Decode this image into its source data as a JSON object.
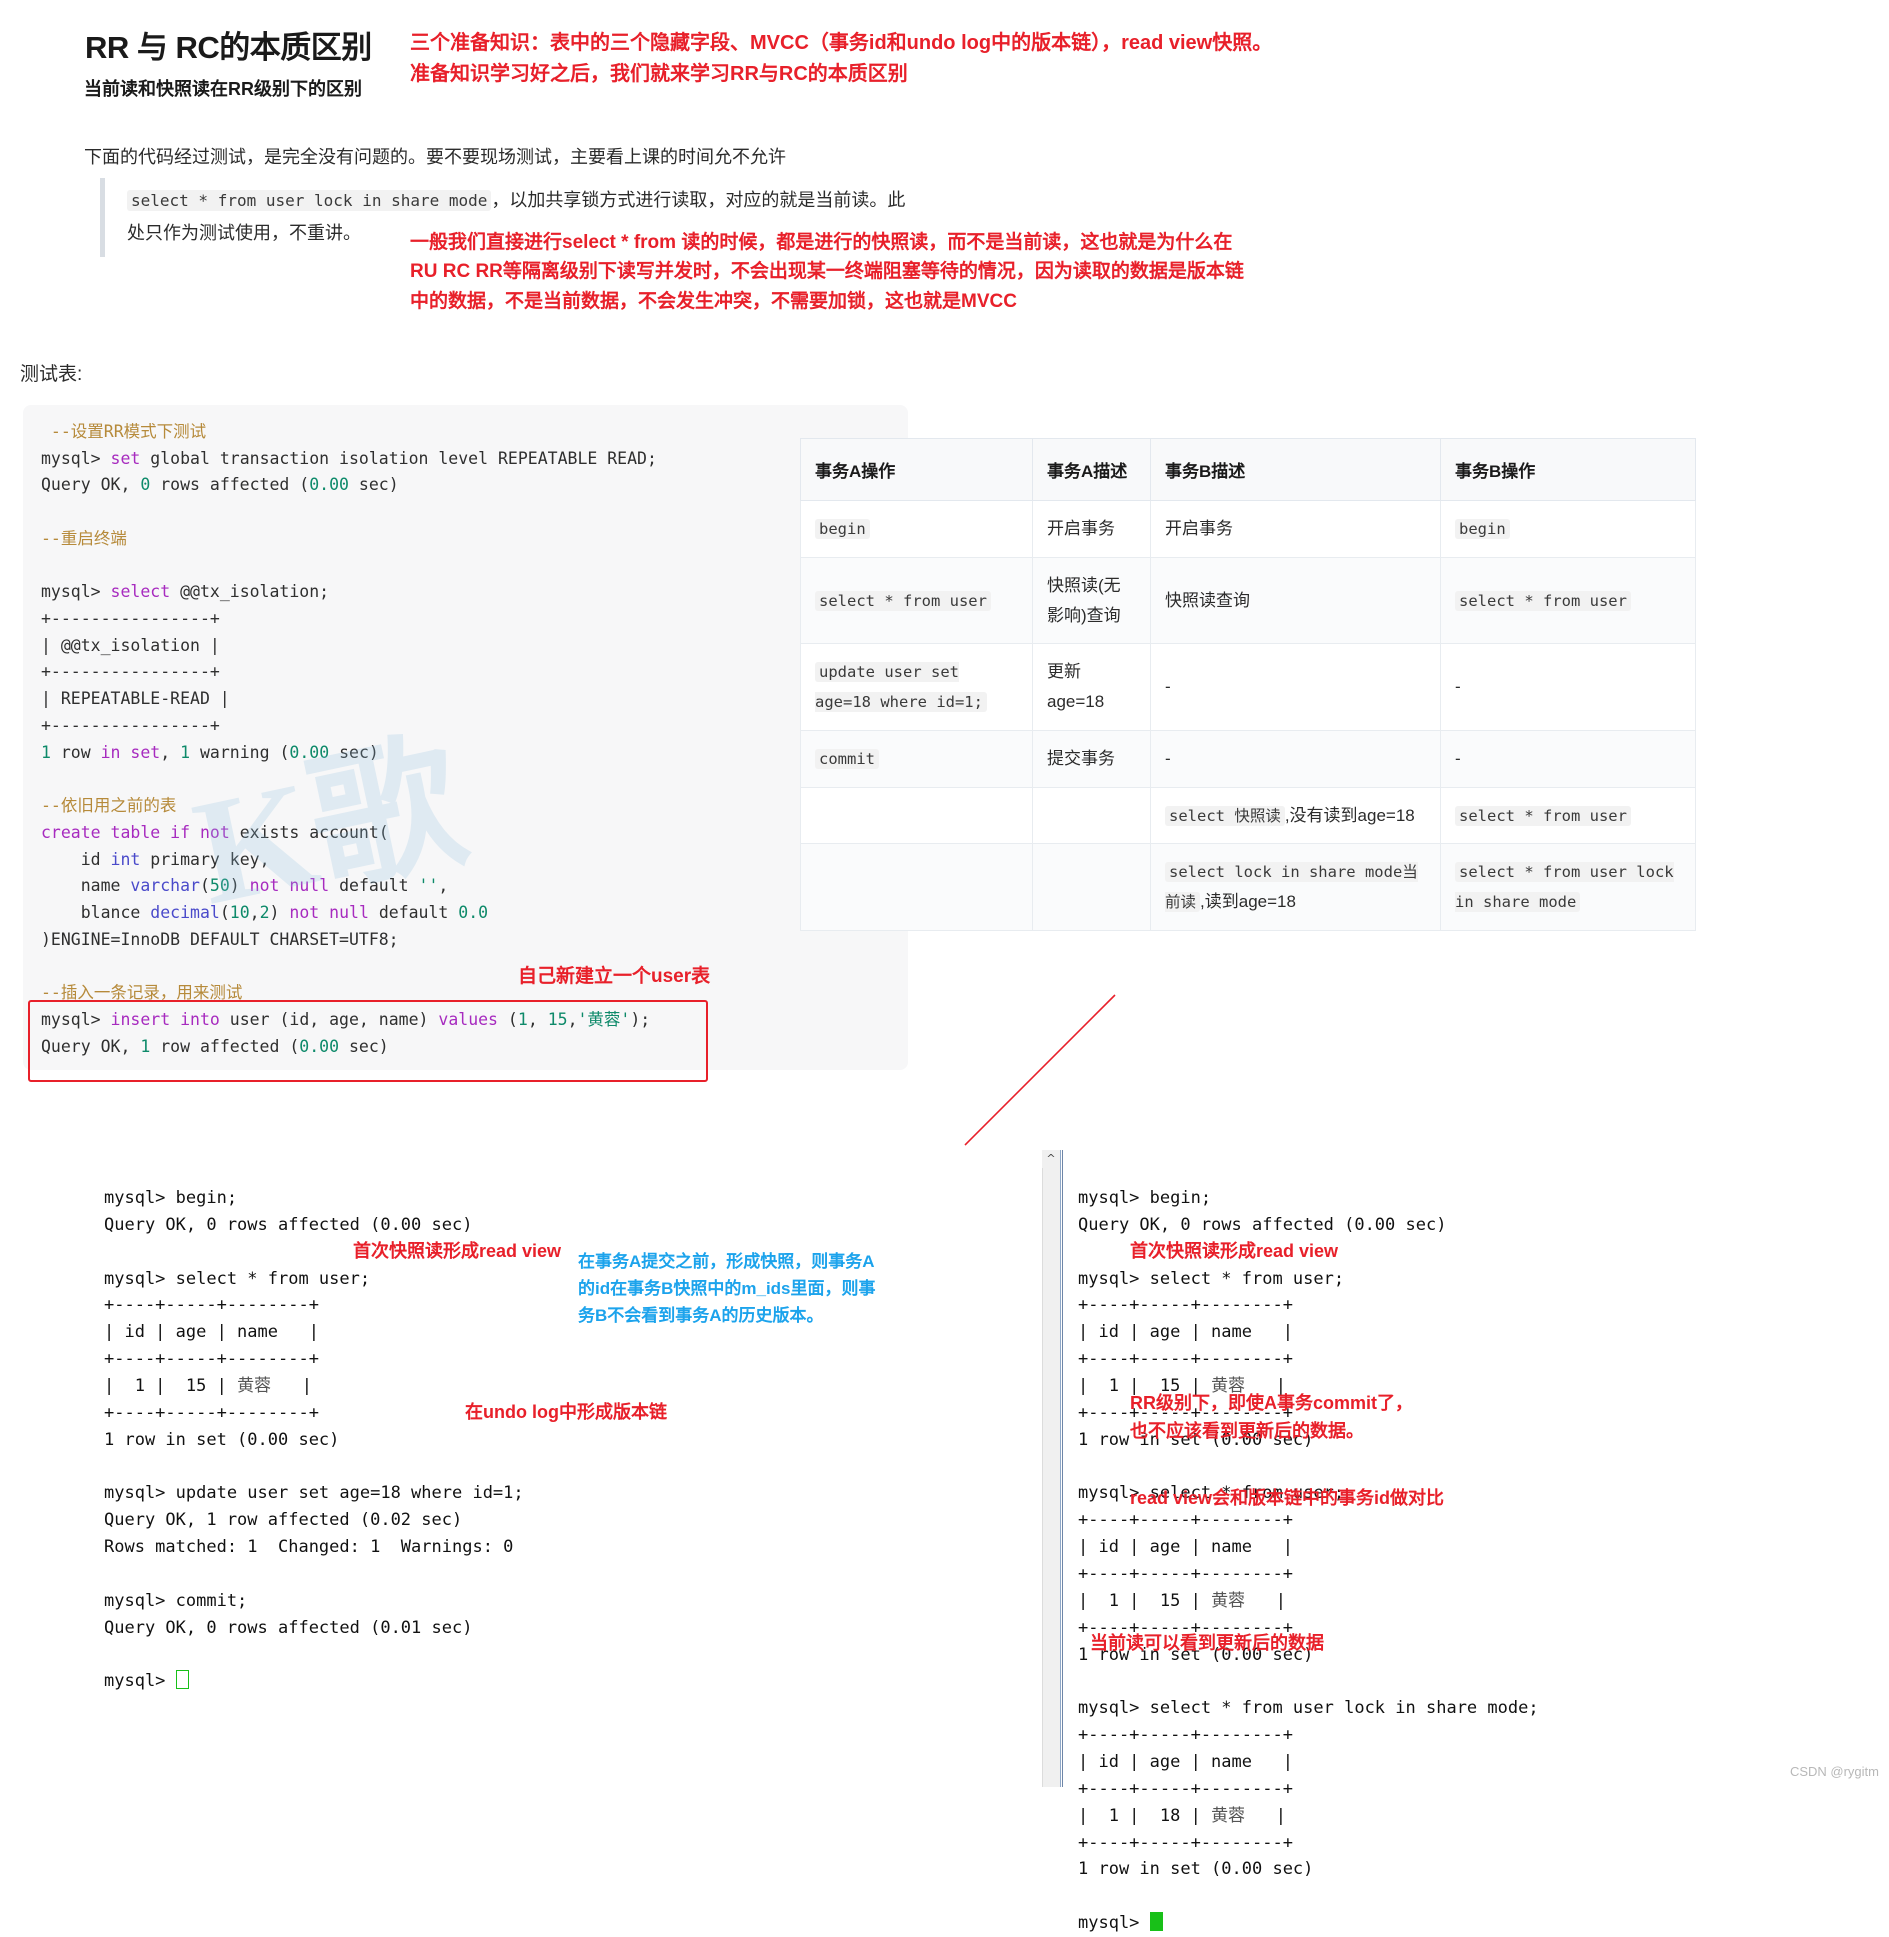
{
  "header": {
    "title": "RR 与 RC的本质区别",
    "subtitle": "当前读和快照读在RR级别下的区别",
    "intro": "下面的代码经过测试，是完全没有问题的。要不要现场测试，主要看上课的时间允不允许",
    "red_note_line1": "三个准备知识：表中的三个隐藏字段、MVCC（事务id和undo log中的版本链），read view快照。",
    "red_note_line2": "准备知识学习好之后，我们就来学习RR与RC的本质区别"
  },
  "quote": {
    "code_inline": "select * from user lock in share mode",
    "text_after": "，以加共享锁方式进行读取，对应的就是当前读。此",
    "line2": "处只作为测试使用，不重讲。"
  },
  "body_red_note": {
    "line1": "一般我们直接进行select * from 读的时候，都是进行的快照读，而不是当前读，这也就是为什么在",
    "line2": "RU RC RR等隔离级别下读写并发时，不会出现某一终端阻塞等待的情况，因为读取的数据是版本链",
    "line3": "中的数据，不是当前数据，不会发生冲突，不需要加锁，这也就是MVCC"
  },
  "test_table_label": "测试表:",
  "code_block": {
    "lines": [
      [
        {
          "t": " --设置RR模式下测试",
          "c": "c-comment"
        }
      ],
      [
        {
          "t": "mysql> ",
          "c": "c-plain"
        },
        {
          "t": "set",
          "c": "c-kw"
        },
        {
          "t": " global transaction isolation level REPEATABLE READ;",
          "c": "c-plain"
        }
      ],
      [
        {
          "t": "Query OK, ",
          "c": "c-plain"
        },
        {
          "t": "0",
          "c": "c-num"
        },
        {
          "t": " rows affected (",
          "c": "c-plain"
        },
        {
          "t": "0.00",
          "c": "c-num"
        },
        {
          "t": " sec)",
          "c": "c-plain"
        }
      ],
      [
        {
          "t": "",
          "c": "c-plain"
        }
      ],
      [
        {
          "t": "--重启终端",
          "c": "c-comment"
        }
      ],
      [
        {
          "t": "",
          "c": "c-plain"
        }
      ],
      [
        {
          "t": "mysql> ",
          "c": "c-plain"
        },
        {
          "t": "select",
          "c": "c-kw"
        },
        {
          "t": " @@tx_isolation;",
          "c": "c-plain"
        }
      ],
      [
        {
          "t": "+----------------+",
          "c": "c-plain"
        }
      ],
      [
        {
          "t": "| @@tx_isolation |",
          "c": "c-plain"
        }
      ],
      [
        {
          "t": "+----------------+",
          "c": "c-plain"
        }
      ],
      [
        {
          "t": "| REPEATABLE-READ |",
          "c": "c-plain"
        }
      ],
      [
        {
          "t": "+----------------+",
          "c": "c-plain"
        }
      ],
      [
        {
          "t": "1",
          "c": "c-num"
        },
        {
          "t": " row ",
          "c": "c-plain"
        },
        {
          "t": "in",
          "c": "c-kw"
        },
        {
          "t": " ",
          "c": "c-plain"
        },
        {
          "t": "set",
          "c": "c-kw"
        },
        {
          "t": ", ",
          "c": "c-plain"
        },
        {
          "t": "1",
          "c": "c-num"
        },
        {
          "t": " warning (",
          "c": "c-plain"
        },
        {
          "t": "0.00",
          "c": "c-num"
        },
        {
          "t": " sec)",
          "c": "c-plain"
        }
      ],
      [
        {
          "t": "",
          "c": "c-plain"
        }
      ],
      [
        {
          "t": "--依旧用之前的表",
          "c": "c-comment"
        }
      ],
      [
        {
          "t": "create",
          "c": "c-kw"
        },
        {
          "t": " ",
          "c": "c-plain"
        },
        {
          "t": "table",
          "c": "c-kw"
        },
        {
          "t": " ",
          "c": "c-plain"
        },
        {
          "t": "if",
          "c": "c-kw"
        },
        {
          "t": " ",
          "c": "c-plain"
        },
        {
          "t": "not",
          "c": "c-kw"
        },
        {
          "t": " exists account(",
          "c": "c-plain"
        }
      ],
      [
        {
          "t": "    id ",
          "c": "c-plain"
        },
        {
          "t": "int",
          "c": "c-type"
        },
        {
          "t": " primary key,",
          "c": "c-plain"
        }
      ],
      [
        {
          "t": "    name ",
          "c": "c-plain"
        },
        {
          "t": "varchar",
          "c": "c-type"
        },
        {
          "t": "(",
          "c": "c-plain"
        },
        {
          "t": "50",
          "c": "c-num"
        },
        {
          "t": ") ",
          "c": "c-plain"
        },
        {
          "t": "not",
          "c": "c-kw"
        },
        {
          "t": " ",
          "c": "c-plain"
        },
        {
          "t": "null",
          "c": "c-kw"
        },
        {
          "t": " default ",
          "c": "c-plain"
        },
        {
          "t": "''",
          "c": "c-str"
        },
        {
          "t": ",",
          "c": "c-plain"
        }
      ],
      [
        {
          "t": "    blance ",
          "c": "c-plain"
        },
        {
          "t": "decimal",
          "c": "c-type"
        },
        {
          "t": "(",
          "c": "c-plain"
        },
        {
          "t": "10",
          "c": "c-num"
        },
        {
          "t": ",",
          "c": "c-plain"
        },
        {
          "t": "2",
          "c": "c-num"
        },
        {
          "t": ") ",
          "c": "c-plain"
        },
        {
          "t": "not",
          "c": "c-kw"
        },
        {
          "t": " ",
          "c": "c-plain"
        },
        {
          "t": "null",
          "c": "c-kw"
        },
        {
          "t": " default ",
          "c": "c-plain"
        },
        {
          "t": "0.0",
          "c": "c-num"
        }
      ],
      [
        {
          "t": ")ENGINE=InnoDB DEFAULT CHARSET=UTF8;",
          "c": "c-plain"
        }
      ],
      [
        {
          "t": "",
          "c": "c-plain"
        }
      ],
      [
        {
          "t": "--插入一条记录，用来测试",
          "c": "c-comment"
        }
      ],
      [
        {
          "t": "mysql> ",
          "c": "c-plain"
        },
        {
          "t": "insert",
          "c": "c-kw"
        },
        {
          "t": " ",
          "c": "c-plain"
        },
        {
          "t": "into",
          "c": "c-kw"
        },
        {
          "t": " user (id, age, name) ",
          "c": "c-plain"
        },
        {
          "t": "values",
          "c": "c-kw"
        },
        {
          "t": " (",
          "c": "c-plain"
        },
        {
          "t": "1",
          "c": "c-num"
        },
        {
          "t": ", ",
          "c": "c-plain"
        },
        {
          "t": "15",
          "c": "c-num"
        },
        {
          "t": ",",
          "c": "c-plain"
        },
        {
          "t": "'黄蓉'",
          "c": "c-str"
        },
        {
          "t": ");",
          "c": "c-plain"
        }
      ],
      [
        {
          "t": "Query OK, ",
          "c": "c-plain"
        },
        {
          "t": "1",
          "c": "c-num"
        },
        {
          "t": " row affected (",
          "c": "c-plain"
        },
        {
          "t": "0.00",
          "c": "c-num"
        },
        {
          "t": " sec)",
          "c": "c-plain"
        }
      ]
    ]
  },
  "insert_note": "自己新建立一个user表",
  "cmp_table": {
    "headers": [
      "事务A操作",
      "事务A描述",
      "事务B描述",
      "事务B操作"
    ],
    "rows": [
      {
        "a_op": [
          {
            "t": "begin",
            "code": true
          }
        ],
        "a_desc": "开启事务",
        "b_desc": [
          {
            "t": "开启事务",
            "code": false
          }
        ],
        "b_op": [
          {
            "t": "begin",
            "code": true
          }
        ]
      },
      {
        "a_op": [
          {
            "t": "select * from user",
            "code": true
          }
        ],
        "a_desc": "快照读(无影响)查询",
        "b_desc": [
          {
            "t": "快照读查询",
            "code": false
          }
        ],
        "b_op": [
          {
            "t": "select * from user",
            "code": true
          }
        ]
      },
      {
        "a_op": [
          {
            "t": "update user set age=18 where id=1;",
            "code": true
          }
        ],
        "a_desc": "更新age=18",
        "b_desc": [
          {
            "t": "-",
            "code": false
          }
        ],
        "b_op": [
          {
            "t": "-",
            "code": false
          }
        ]
      },
      {
        "a_op": [
          {
            "t": "commit",
            "code": true
          }
        ],
        "a_desc": "提交事务",
        "b_desc": [
          {
            "t": "-",
            "code": false
          }
        ],
        "b_op": [
          {
            "t": "-",
            "code": false
          }
        ]
      },
      {
        "a_op": [],
        "a_desc": "",
        "b_desc": [
          {
            "t": "select 快照读",
            "code": true
          },
          {
            "t": ",没有读到age=18",
            "code": false
          }
        ],
        "b_op": [
          {
            "t": "select * from user",
            "code": true
          }
        ]
      },
      {
        "a_op": [],
        "a_desc": "",
        "b_desc": [
          {
            "t": "select lock in share mode当前读",
            "code": true
          },
          {
            "t": ",读到age=18",
            "code": false
          }
        ],
        "b_op": [
          {
            "t": "select * from user lock in share mode",
            "code": true
          }
        ]
      }
    ]
  },
  "terminal_a": {
    "lines": [
      "mysql> begin;",
      "Query OK, 0 rows affected (0.00 sec)",
      "",
      "mysql> select * from user;",
      "+----+-----+--------+",
      "| id | age | name   |",
      "+----+-----+--------+",
      "|  1 |  15 | 黄蓉   |",
      "+----+-----+--------+",
      "1 row in set (0.00 sec)",
      "",
      "mysql> update user set age=18 where id=1;",
      "Query OK, 1 row affected (0.02 sec)",
      "Rows matched: 1  Changed: 1  Warnings: 0",
      "",
      "mysql> commit;",
      "Query OK, 0 rows affected (0.01 sec)",
      "",
      "mysql> "
    ]
  },
  "terminal_b": {
    "lines": [
      "mysql> begin;",
      "Query OK, 0 rows affected (0.00 sec)",
      "",
      "mysql> select * from user;",
      "+----+-----+--------+",
      "| id | age | name   |",
      "+----+-----+--------+",
      "|  1 |  15 | 黄蓉   |",
      "+----+-----+--------+",
      "1 row in set (0.00 sec)",
      "",
      "mysql> select * from user;",
      "+----+-----+--------+",
      "| id | age | name   |",
      "+----+-----+--------+",
      "|  1 |  15 | 黄蓉   |",
      "+----+-----+--------+",
      "1 row in set (0.00 sec)",
      "",
      "mysql> select * from user lock in share mode;",
      "+----+-----+--------+",
      "| id | age | name   |",
      "+----+-----+--------+",
      "|  1 |  18 | 黄蓉   |",
      "+----+-----+--------+",
      "1 row in set (0.00 sec)",
      "",
      "mysql> "
    ]
  },
  "annotations": {
    "a1": "首次快照读形成read view",
    "a2": "在undo log中形成版本链",
    "middle_blue_l1": "在事务A提交之前，形成快照，则事务A",
    "middle_blue_l2": "的id在事务B快照中的m_ids里面，则事",
    "middle_blue_l3": "务B不会看到事务A的历史版本。",
    "b1": "首次快照读形成read view",
    "b2_l1": "RR级别下，即使A事务commit了，",
    "b2_l2": "也不应该看到更新后的数据。",
    "b3": "read view会和版本链中的事务id做对比",
    "b4": "当前读可以看到更新后的数据"
  },
  "watermark": "CSDN @rygitm"
}
